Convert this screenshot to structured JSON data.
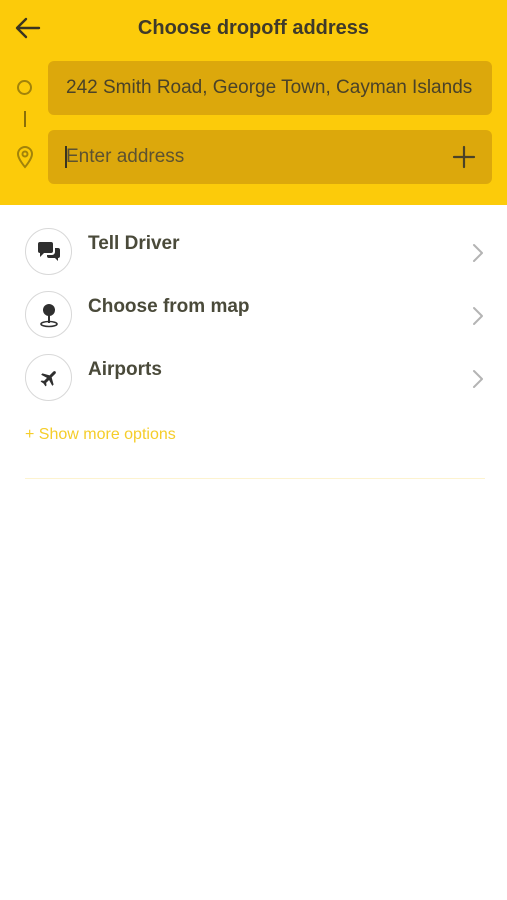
{
  "header": {
    "title": "Choose dropoff address",
    "back_icon": "arrow-left-icon"
  },
  "route": {
    "pickup_value": "242 Smith Road, George Town, Cayman Islands",
    "dropoff_placeholder": "Enter address",
    "add_stop_icon": "plus-icon"
  },
  "options": [
    {
      "label": "Tell Driver",
      "icon": "chat-bubbles-icon"
    },
    {
      "label": "Choose from map",
      "icon": "map-pin-icon"
    },
    {
      "label": "Airports",
      "icon": "airplane-icon"
    }
  ],
  "show_more_label": "+ Show more options",
  "colors": {
    "accent": "#FCCB0A",
    "field": "#DCA80C",
    "link": "#F5CD2A"
  }
}
